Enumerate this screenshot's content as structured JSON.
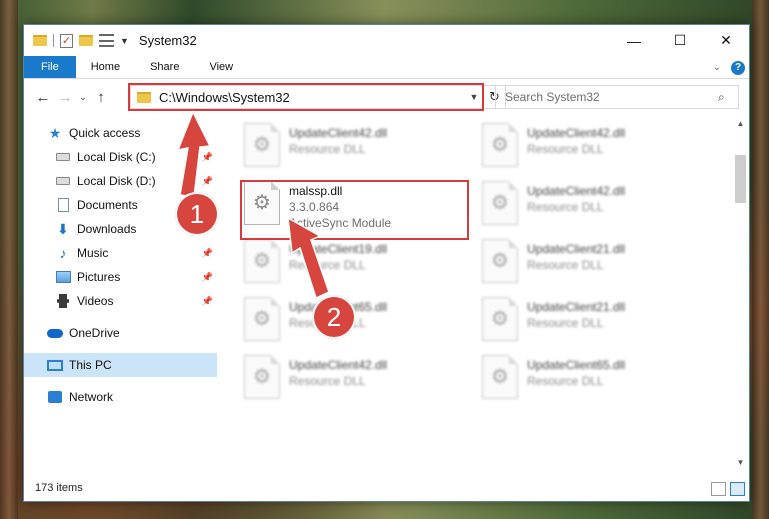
{
  "window": {
    "title": "System32",
    "controls": {
      "minimize": "—",
      "maximize": "☐",
      "close": "✕"
    }
  },
  "ribbon": {
    "tabs": [
      "File",
      "Home",
      "Share",
      "View"
    ],
    "help": "?"
  },
  "nav": {
    "back": "←",
    "forward": "→",
    "recent": "⌄",
    "up": "↑",
    "address": "C:\\Windows\\System32",
    "refresh": "↻",
    "search_placeholder": "Search System32",
    "search_icon": "⌕"
  },
  "sidebar": {
    "items": [
      {
        "label": "Quick access",
        "icon": "star-icon",
        "level": 0
      },
      {
        "label": "Local Disk (C:)",
        "icon": "drive-icon",
        "level": 1,
        "pinned": true
      },
      {
        "label": "Local Disk (D:)",
        "icon": "drive-icon",
        "level": 1,
        "pinned": true
      },
      {
        "label": "Documents",
        "icon": "document-icon",
        "level": 1,
        "pinned": true
      },
      {
        "label": "Downloads",
        "icon": "download-icon",
        "level": 1,
        "pinned": true
      },
      {
        "label": "Music",
        "icon": "music-icon",
        "level": 1,
        "pinned": true
      },
      {
        "label": "Pictures",
        "icon": "pictures-icon",
        "level": 1,
        "pinned": true
      },
      {
        "label": "Videos",
        "icon": "videos-icon",
        "level": 1,
        "pinned": true
      },
      {
        "label": "OneDrive",
        "icon": "cloud-icon",
        "level": 0
      },
      {
        "label": "This PC",
        "icon": "computer-icon",
        "level": 0,
        "selected": true
      },
      {
        "label": "Network",
        "icon": "network-icon",
        "level": 0
      }
    ]
  },
  "files": {
    "left": [
      {
        "name": "UpdateClient42.dll",
        "sub": "Resource DLL"
      },
      {
        "name": "malssp.dll",
        "version": "3.3.0.864",
        "desc": "ActiveSync Module"
      },
      {
        "name": "UpdateClient19.dll",
        "sub": "Resource DLL"
      },
      {
        "name": "UpdateClient65.dll",
        "sub": "Resource DLL"
      },
      {
        "name": "UpdateClient42.dll",
        "sub": "Resource DLL"
      }
    ],
    "right": [
      {
        "name": "UpdateClient42.dll",
        "sub": "Resource DLL"
      },
      {
        "name": "UpdateClient42.dll",
        "sub": "Resource DLL"
      },
      {
        "name": "UpdateClient21.dll",
        "sub": "Resource DLL"
      },
      {
        "name": "UpdateClient21.dll",
        "sub": "Resource DLL"
      },
      {
        "name": "UpdateClient65.dll",
        "sub": "Resource DLL"
      }
    ]
  },
  "status": {
    "items": "173 items"
  },
  "annotations": {
    "badge1": "1",
    "badge2": "2",
    "color": "#d63a3a"
  }
}
